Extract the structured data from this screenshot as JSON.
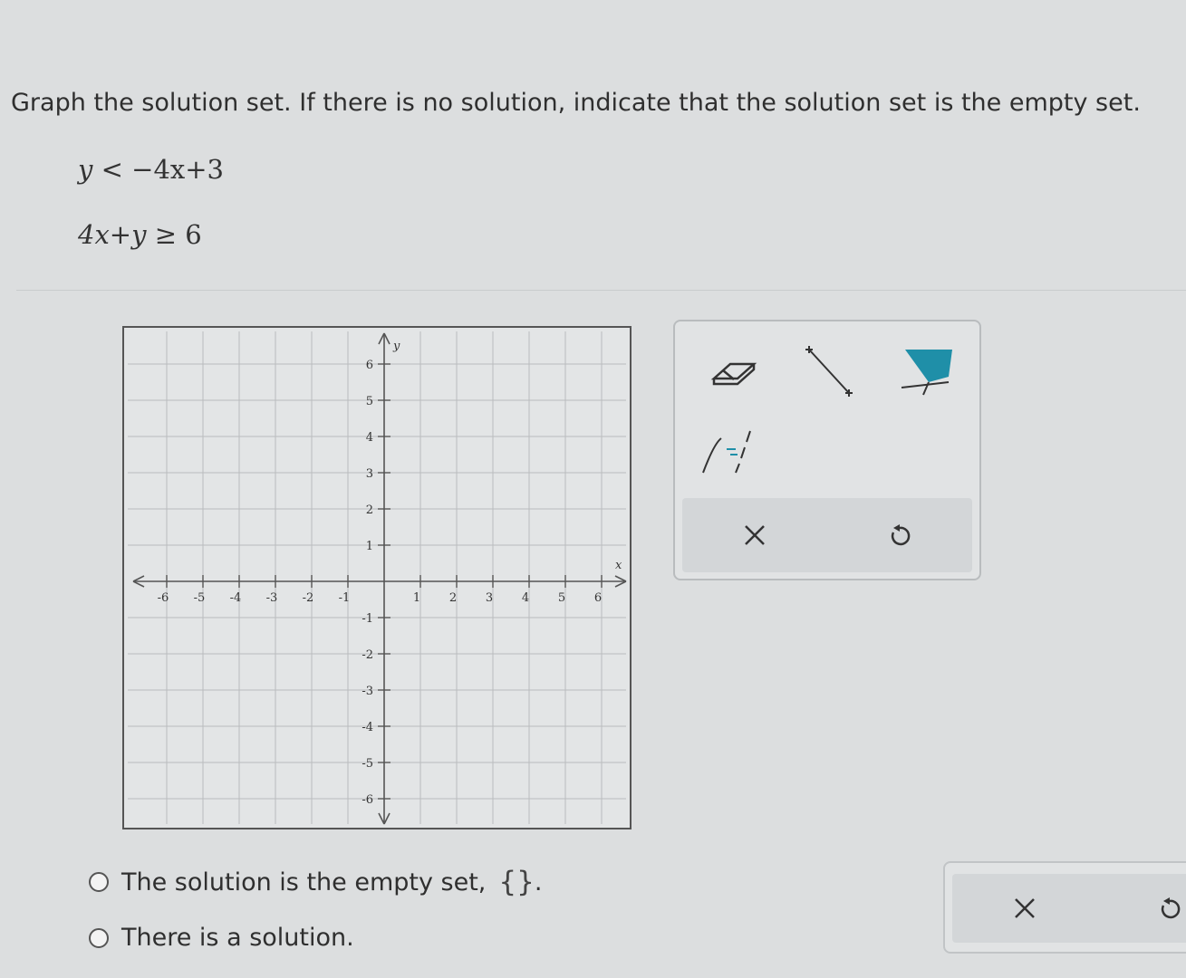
{
  "prompt": "Graph the solution set. If there is no solution, indicate that the solution set is the empty set.",
  "inequalities": [
    {
      "lhs": "y",
      "op": "<",
      "rhs": "−4x+3"
    },
    {
      "lhs": "4x+y",
      "op": "≥",
      "rhs": "6"
    }
  ],
  "graph": {
    "x_min": -6,
    "x_max": 6,
    "y_min": -6,
    "y_max": 6,
    "x_axis_label": "x",
    "y_axis_label": "y",
    "x_ticks": [
      "-6",
      "-5",
      "-4",
      "-3",
      "-2",
      "-1",
      "1",
      "2",
      "3",
      "4",
      "5",
      "6"
    ],
    "y_ticks": [
      "6",
      "5",
      "4",
      "3",
      "2",
      "1",
      "-1",
      "-2",
      "-3",
      "-4",
      "-5",
      "-6"
    ]
  },
  "tools": [
    "eraser-icon",
    "line-segment-icon",
    "shade-region-icon",
    "dashed-solid-toggle-icon"
  ],
  "tool_actions": [
    "clear-icon",
    "undo-icon"
  ],
  "choices": {
    "empty": {
      "label": "The solution is the empty set,",
      "braces": "{}",
      "end": "."
    },
    "solution": {
      "label": "There is a solution."
    }
  },
  "colors": {
    "accent": "#1f8fa8",
    "grid": "#b9bcbe",
    "axis": "#555555"
  }
}
